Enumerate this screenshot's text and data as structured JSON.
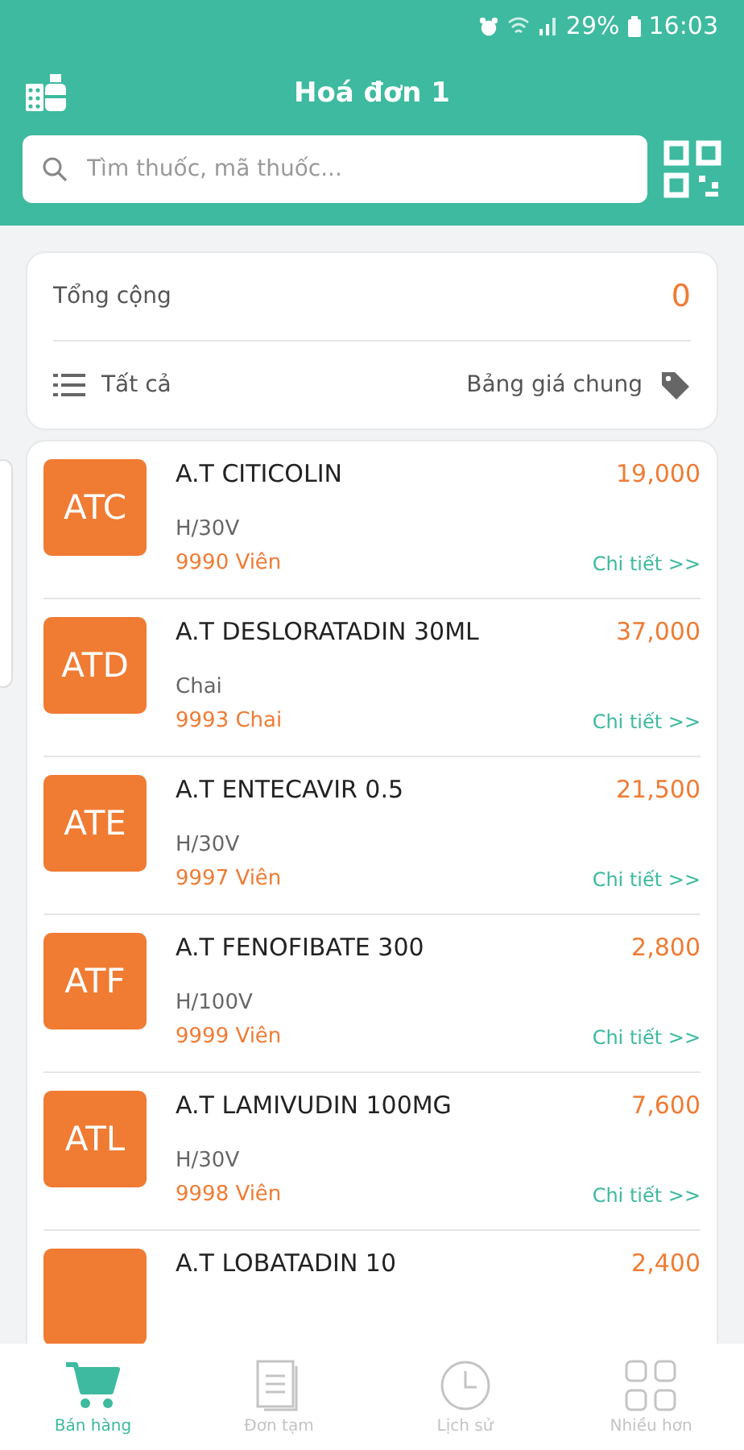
{
  "status_bar": {
    "battery": "29%",
    "time": "16:03"
  },
  "header": {
    "title": "Hoá đơn 1"
  },
  "search": {
    "placeholder": "Tìm thuốc, mã thuốc..."
  },
  "summary": {
    "total_label": "Tổng cộng",
    "total_value": "0",
    "filter_label": "Tất cả",
    "price_list": "Bảng giá chung"
  },
  "products": [
    {
      "code": "ATC",
      "name": "A.T CITICOLIN",
      "price": "19,000",
      "unit": "H/30V",
      "stock": "9990 Viên",
      "detail": "Chi tiết >>"
    },
    {
      "code": "ATD",
      "name": "A.T DESLORATADIN 30ML",
      "price": "37,000",
      "unit": "Chai",
      "stock": "9993 Chai",
      "detail": "Chi tiết >>"
    },
    {
      "code": "ATE",
      "name": "A.T ENTECAVIR 0.5",
      "price": "21,500",
      "unit": "H/30V",
      "stock": "9997 Viên",
      "detail": "Chi tiết >>"
    },
    {
      "code": "ATF",
      "name": "A.T FENOFIBATE 300",
      "price": "2,800",
      "unit": "H/100V",
      "stock": "9999 Viên",
      "detail": "Chi tiết >>"
    },
    {
      "code": "ATL",
      "name": "A.T LAMIVUDIN 100MG",
      "price": "7,600",
      "unit": "H/30V",
      "stock": "9998 Viên",
      "detail": "Chi tiết >>"
    },
    {
      "name": "A.T LOBATADIN 10",
      "price": "2,400"
    }
  ],
  "nav": [
    {
      "kind": "cart",
      "label": "Bán hàng",
      "selected": true
    },
    {
      "kind": "doc",
      "label": "Đơn tạm",
      "selected": false
    },
    {
      "kind": "clock",
      "label": "Lịch sử",
      "selected": false
    },
    {
      "kind": "grid",
      "label": "Nhiều hơn",
      "selected": false
    }
  ]
}
